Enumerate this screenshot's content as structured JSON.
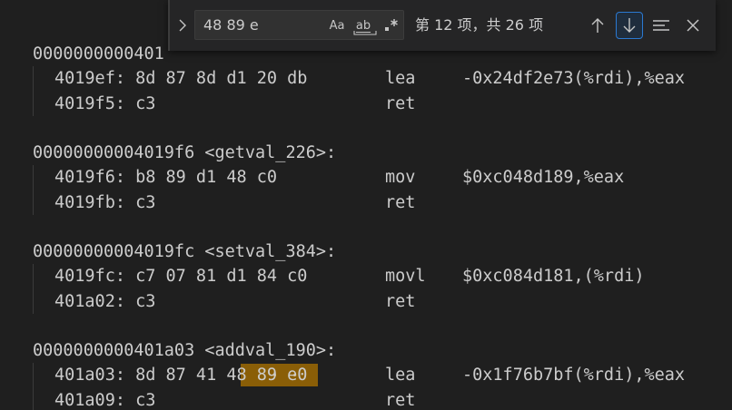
{
  "editor": {
    "lines": [
      {
        "kind": "label",
        "text": "0000000000401"
      },
      {
        "kind": "instr",
        "addr": "4019ef: 8d 87 8d d1 20 db",
        "mnemonic": "lea",
        "operands": "-0x24df2e73(%rdi),%eax"
      },
      {
        "kind": "instr",
        "addr": "4019f5: c3",
        "mnemonic": "ret",
        "operands": ""
      },
      {
        "kind": "blank"
      },
      {
        "kind": "label",
        "text": "00000000004019f6 <getval_226>:"
      },
      {
        "kind": "instr",
        "addr": "4019f6: b8 89 d1 48 c0",
        "mnemonic": "mov",
        "operands": "$0xc048d189,%eax"
      },
      {
        "kind": "instr",
        "addr": "4019fb: c3",
        "mnemonic": "ret",
        "operands": ""
      },
      {
        "kind": "blank"
      },
      {
        "kind": "label",
        "text": "00000000004019fc <setval_384>:"
      },
      {
        "kind": "instr",
        "addr": "4019fc: c7 07 81 d1 84 c0",
        "mnemonic": "movl",
        "operands": "$0xc084d181,(%rdi)"
      },
      {
        "kind": "instr",
        "addr": "401a02: c3",
        "mnemonic": "ret",
        "operands": ""
      },
      {
        "kind": "blank"
      },
      {
        "kind": "label",
        "text": "0000000000401a03 <addval_190>:"
      },
      {
        "kind": "instr",
        "addr": "401a03: 8d 87 41 48 89 e0",
        "mnemonic": "lea",
        "operands": "-0x1f76b7bf(%rdi),%eax",
        "highlight": true
      },
      {
        "kind": "instr",
        "addr": "401a09: c3",
        "mnemonic": "ret",
        "operands": ""
      }
    ]
  },
  "find": {
    "query": "48 89 e",
    "match_case_label": "Aa",
    "whole_word_label": "ab",
    "regex_label": ".*",
    "match_count": "第 12 项，共 26 项",
    "toggle_replace_icon": "chevron-right-icon",
    "prev_icon": "arrow-up-icon",
    "next_icon": "arrow-down-icon",
    "selection_icon": "find-in-selection-icon",
    "close_icon": "close-icon"
  },
  "colors": {
    "background": "#1f1f1f",
    "text": "#cccccc",
    "match_highlight": "#9e6a03",
    "focus_border": "#2b79d1"
  }
}
